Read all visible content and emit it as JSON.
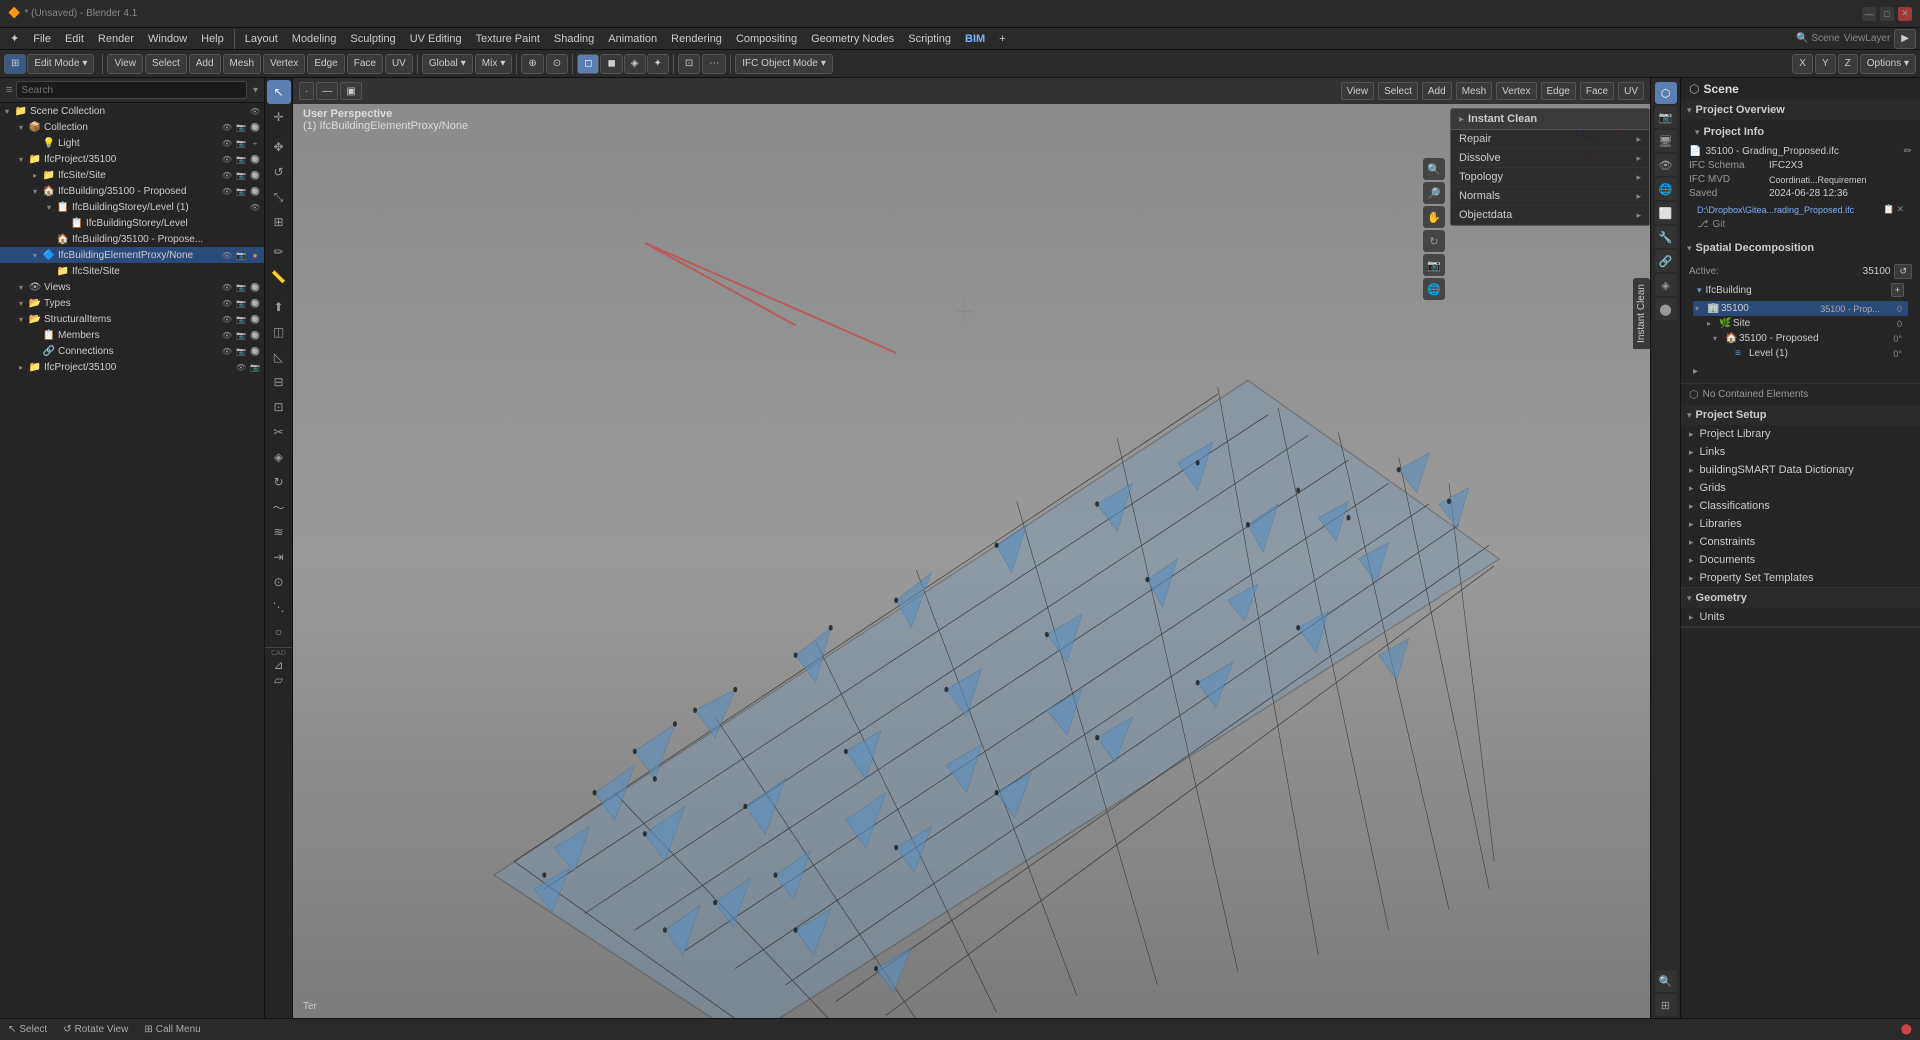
{
  "window": {
    "title": "* (Unsaved) - Blender 4.1"
  },
  "titlebar": {
    "win_controls": [
      "—",
      "□",
      "✕"
    ]
  },
  "menubar": {
    "items": [
      "✦",
      "File",
      "Edit",
      "Render",
      "Window",
      "Help",
      "Layout",
      "Modeling",
      "Sculpting",
      "UV Editing",
      "Texture Paint",
      "Shading",
      "Animation",
      "Rendering",
      "Compositing",
      "Geometry Nodes",
      "Scripting",
      "BIM",
      "+"
    ]
  },
  "toolbar": {
    "mode": "Edit Mode",
    "view": "View",
    "select": "Select",
    "add": "Add",
    "mesh": "Mesh",
    "vertex": "Vertex",
    "edge": "Edge",
    "face": "Face",
    "uv": "UV",
    "transform": "Global",
    "pivot": "Mix",
    "shading_label": "IFC Object Mode"
  },
  "outliner": {
    "header": {
      "search_placeholder": "Search"
    },
    "items": [
      {
        "level": 0,
        "label": "Scene Collection",
        "expanded": true,
        "icon": "📁"
      },
      {
        "level": 1,
        "label": "Collection",
        "expanded": true,
        "icon": "📦"
      },
      {
        "level": 2,
        "label": "Light",
        "expanded": false,
        "icon": "💡"
      },
      {
        "level": 1,
        "label": "IfcProject/35100",
        "expanded": true,
        "icon": "📁"
      },
      {
        "level": 2,
        "label": "IfcSite/Site",
        "expanded": false,
        "icon": "📁"
      },
      {
        "level": 2,
        "label": "IfcBuilding/35100 - Proposed",
        "expanded": true,
        "icon": "🏠"
      },
      {
        "level": 3,
        "label": "IfcBuildingStorey/Level (1)",
        "expanded": true,
        "icon": "📋"
      },
      {
        "level": 4,
        "label": "IfcBuildingStorey/Level",
        "expanded": false,
        "icon": "📋"
      },
      {
        "level": 3,
        "label": "IfcBuilding/35100 - Propose...",
        "expanded": false,
        "icon": "🏠"
      },
      {
        "level": 2,
        "label": "IfcBuildingElementProxy/None",
        "expanded": true,
        "selected": true,
        "icon": "🔷"
      },
      {
        "level": 3,
        "label": "IfcSite/Site",
        "expanded": false,
        "icon": "📁"
      },
      {
        "level": 1,
        "label": "Views",
        "expanded": false,
        "icon": "👁"
      },
      {
        "level": 1,
        "label": "Types",
        "expanded": false,
        "icon": "📂"
      },
      {
        "level": 1,
        "label": "StructuralItems",
        "expanded": true,
        "icon": "📂"
      },
      {
        "level": 2,
        "label": "Members",
        "expanded": false,
        "icon": "📋"
      },
      {
        "level": 2,
        "label": "Connections",
        "expanded": false,
        "icon": "🔗"
      },
      {
        "level": 1,
        "label": "IfcProject/35100",
        "expanded": false,
        "icon": "📁"
      }
    ]
  },
  "viewport": {
    "label_main": "User Perspective",
    "label_sub": "(1) IfcBuildingElementProxy/None",
    "mode": "Edit Mode",
    "overlay": "IFC Object Mode"
  },
  "instant_clean": {
    "title": "Instant Clean",
    "items": [
      {
        "label": "Repair",
        "has_arrow": true
      },
      {
        "label": "Dissolve",
        "has_arrow": true
      },
      {
        "label": "Topology",
        "has_arrow": true
      },
      {
        "label": "Normals",
        "has_arrow": true
      },
      {
        "label": "Objectdata",
        "has_arrow": true
      }
    ]
  },
  "right_sidebar": {
    "scene_label": "Scene",
    "project_overview_label": "Project Overview",
    "project_info": {
      "title": "Project Info",
      "file_name": "35100 - Grading_Proposed.ifc",
      "schema_label": "IFC Schema",
      "schema_value": "IFC2X3",
      "mvd_label": "IFC MVD",
      "mvd_value": "Coordinati...Requiremen",
      "saved_label": "Saved",
      "saved_value": "2024-06-28 12:36",
      "file_path": "D:\\Dropbox\\Gitea...rading_Proposed.ifc",
      "git_label": "Git"
    },
    "spatial": {
      "title": "Spatial Decomposition",
      "active_label": "Active:",
      "active_value": "35100",
      "ifc_building": "IfcBuilding",
      "items": [
        {
          "label": "35100",
          "value": "35100 - Prop...",
          "count": "0",
          "selected": true
        },
        {
          "sub_items": [
            {
              "label": "Site",
              "count": "0"
            },
            {
              "label": "35100 - Proposed",
              "count": "0°"
            },
            {
              "label": "Level (1)",
              "count": "0°"
            }
          ]
        }
      ]
    },
    "no_contained": "No Contained Elements",
    "project_setup": {
      "title": "Project Setup",
      "items": [
        "Project Library",
        "Links",
        "buildingSMART Data Dictionary",
        "Grids",
        "Classifications",
        "Libraries",
        "Constraints",
        "Documents",
        "Property Set Templates"
      ]
    },
    "geometry": {
      "title": "Geometry",
      "items": [
        "Units"
      ]
    }
  },
  "statusbar": {
    "select": "Select",
    "rotate": "Rotate View",
    "call_menu": "Call Menu",
    "error_icon": "⬤"
  },
  "colors": {
    "accent_blue": "#5a7fb0",
    "accent_orange": "#e8963c",
    "bg_dark": "#1a1a1a",
    "bg_panel": "#252525",
    "bg_header": "#2a2a2a",
    "border": "#111",
    "selected_item": "#2a4a7a"
  }
}
